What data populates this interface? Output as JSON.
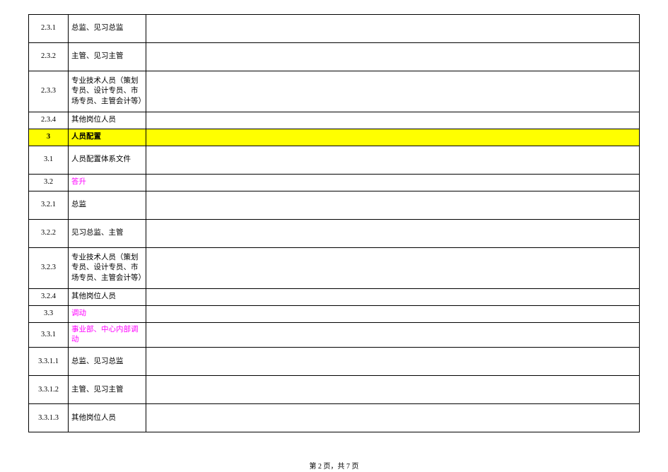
{
  "rows": [
    {
      "num": "2.3.1",
      "label": "总监、见习总监",
      "cls": "tall"
    },
    {
      "num": "2.3.2",
      "label": "主管、见习主管",
      "cls": "tall"
    },
    {
      "num": "2.3.3",
      "label": "专业技术人员（策划专员、设计专员、市场专员、主管会计等）",
      "cls": "xtall"
    },
    {
      "num": "2.3.4",
      "label": "其他岗位人员",
      "cls": "short"
    },
    {
      "num": "3",
      "label": "人员配置",
      "hdr": true,
      "cls": "short"
    },
    {
      "num": "3.1",
      "label": "人员配置体系文件",
      "cls": "tall"
    },
    {
      "num": "3.2",
      "label": "答升",
      "magenta": true,
      "cls": "short"
    },
    {
      "num": "3.2.1",
      "label": "总监",
      "cls": "tall"
    },
    {
      "num": "3.2.2",
      "label": "见习总监、主管",
      "cls": "tall"
    },
    {
      "num": "3.2.3",
      "label": "专业技术人员（策划专员、设计专员、市场专员、主管会计等）",
      "cls": "xtall"
    },
    {
      "num": "3.2.4",
      "label": "其他岗位人员",
      "cls": "short"
    },
    {
      "num": "3.3",
      "label": "调动",
      "magenta": true,
      "cls": "short"
    },
    {
      "num": "3.3.1",
      "label": "事业部、中心内部调动",
      "magenta": true,
      "cls": "short"
    },
    {
      "num": "3.3.1.1",
      "label": "总监、见习总监",
      "cls": "tall"
    },
    {
      "num": "3.3.1.2",
      "label": "主管、见习主管",
      "cls": "tall"
    },
    {
      "num": "3.3.1.3",
      "label": "其他岗位人员",
      "cls": "tall"
    }
  ],
  "footer": "第 2 页，共 7 页"
}
